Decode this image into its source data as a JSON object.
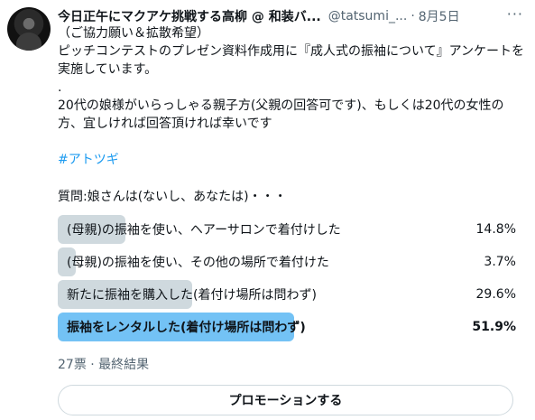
{
  "tweet": {
    "author_name": "今日正午にマクアケ挑戦する高柳 @ 和装バ...",
    "handle": "@tatsumi_...",
    "separator": "·",
    "date": "8月5日",
    "more_icon": "more-horizontal-icon",
    "text_line1": "（ご協力願い＆拡散希望）",
    "text_line2": "ピッチコンテストのプレゼン資料作成用に『成人式の振袖について』アンケートを実施しています。",
    "text_line3": ".",
    "text_line4": "20代の娘様がいらっしゃる親子方(父親の回答可です)、もしくは20代の女性の方、宜しければ回答頂ければ幸いです",
    "hashtag": "#アトツギ",
    "question": "質問:娘さんは(ないし、あなたは)・・・"
  },
  "poll": {
    "options": [
      {
        "label": "(母親)の振袖を使い、ヘアーサロンで着付けした",
        "percent_text": "14.8%",
        "percent": 14.8
      },
      {
        "label": "(母親)の振袖を使い、その他の場所で着付けた",
        "percent_text": "3.7%",
        "percent": 3.7
      },
      {
        "label": "新たに振袖を購入した(着付け場所は問わず)",
        "percent_text": "29.6%",
        "percent": 29.6
      },
      {
        "label": "振袖をレンタルした(着付け場所は問わず)",
        "percent_text": "51.9%",
        "percent": 51.9
      }
    ],
    "votes_summary": "27票 · 最終結果"
  },
  "promote_button": "プロモーションする",
  "colors": {
    "text": "#0f1419",
    "muted": "#536471",
    "link": "#1d9bf0",
    "bar": "#cfd9de",
    "bar_winner": "#73c2f5"
  }
}
